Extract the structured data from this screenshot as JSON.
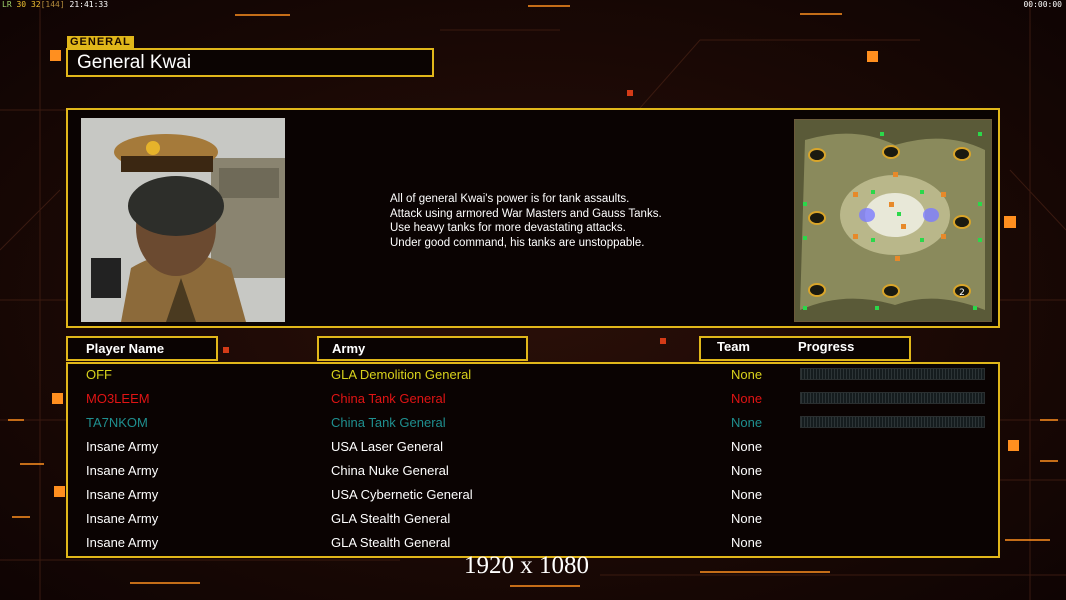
{
  "hud": {
    "fps_label": "LR",
    "fps_a": "30",
    "fps_b": "32",
    "fps_c": "[144]",
    "clock": "21:41:33",
    "timer": "00:00:00"
  },
  "general": {
    "tag": "GENERAL",
    "name": "General Kwai",
    "description": [
      "All of general Kwai's power is for tank assaults.",
      "Attack using armored War Masters and Gauss Tanks.",
      "Use heavy tanks for more devastating attacks.",
      "Under good command, his tanks are unstoppable."
    ]
  },
  "minimap": {
    "start_label": "2"
  },
  "headers": {
    "player": "Player Name",
    "army": "Army",
    "team": "Team",
    "progress": "Progress"
  },
  "players": [
    {
      "name": "OFF",
      "army": "GLA Demolition General",
      "team": "None",
      "color": "#d8d21c",
      "progress": 0,
      "show_bar": true
    },
    {
      "name": "MO3LEEM",
      "army": "China Tank General",
      "team": "None",
      "color": "#e01414",
      "progress": 0,
      "show_bar": true
    },
    {
      "name": "TA7NKOM",
      "army": "China Tank General",
      "team": "None",
      "color": "#1f8f8f",
      "progress": 0,
      "show_bar": true
    },
    {
      "name": "Insane Army",
      "army": "USA Laser General",
      "team": "None",
      "color": "#ffffff",
      "show_bar": false
    },
    {
      "name": "Insane Army",
      "army": "China Nuke General",
      "team": "None",
      "color": "#ffffff",
      "show_bar": false
    },
    {
      "name": "Insane Army",
      "army": "USA Cybernetic General",
      "team": "None",
      "color": "#ffffff",
      "show_bar": false
    },
    {
      "name": "Insane Army",
      "army": "GLA Stealth General",
      "team": "None",
      "color": "#ffffff",
      "show_bar": false
    },
    {
      "name": "Insane Army",
      "army": "GLA Stealth General",
      "team": "None",
      "color": "#ffffff",
      "show_bar": false
    }
  ],
  "resolution_caption": "1920 x 1080",
  "colors": {
    "accent": "#e1b71a",
    "orange_glow": "#ff8c1a"
  }
}
